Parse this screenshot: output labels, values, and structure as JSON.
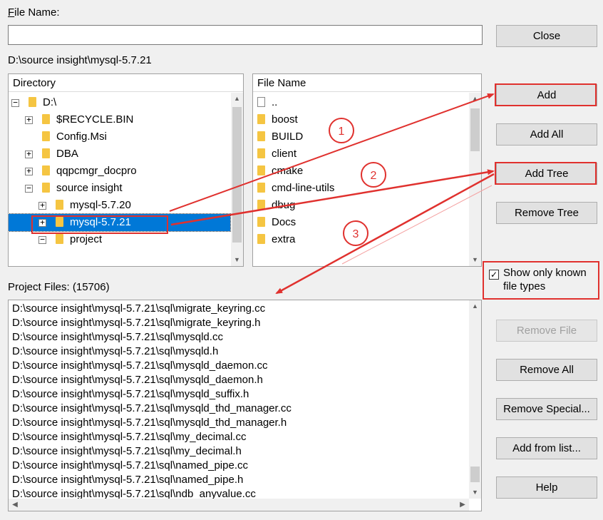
{
  "file_name": {
    "label": "File Name:",
    "value": ""
  },
  "current_path": "D:\\source insight\\mysql-5.7.21",
  "directory": {
    "header": "Directory",
    "items": [
      {
        "label": "D:\\",
        "expander": "−"
      },
      {
        "label": "$RECYCLE.BIN",
        "expander": "+"
      },
      {
        "label": "Config.Msi",
        "expander": ""
      },
      {
        "label": "DBA",
        "expander": "+"
      },
      {
        "label": "qqpcmgr_docpro",
        "expander": "+"
      },
      {
        "label": "source insight",
        "expander": "−"
      },
      {
        "label": "mysql-5.7.20",
        "expander": "+"
      },
      {
        "label": "mysql-5.7.21",
        "expander": "+",
        "selected": true
      },
      {
        "label": "project",
        "expander": "−"
      }
    ]
  },
  "filename_panel": {
    "header": "File Name",
    "items": [
      {
        "label": "..",
        "icon": "file"
      },
      {
        "label": "boost",
        "icon": "folder"
      },
      {
        "label": "BUILD",
        "icon": "folder"
      },
      {
        "label": "client",
        "icon": "folder"
      },
      {
        "label": "cmake",
        "icon": "folder"
      },
      {
        "label": "cmd-line-utils",
        "icon": "folder"
      },
      {
        "label": "dbug",
        "icon": "folder"
      },
      {
        "label": "Docs",
        "icon": "folder"
      },
      {
        "label": "extra",
        "icon": "folder"
      }
    ]
  },
  "project_files": {
    "label": "Project Files: (15706)",
    "items": [
      "D:\\source insight\\mysql-5.7.21\\sql\\migrate_keyring.cc",
      "D:\\source insight\\mysql-5.7.21\\sql\\migrate_keyring.h",
      "D:\\source insight\\mysql-5.7.21\\sql\\mysqld.cc",
      "D:\\source insight\\mysql-5.7.21\\sql\\mysqld.h",
      "D:\\source insight\\mysql-5.7.21\\sql\\mysqld_daemon.cc",
      "D:\\source insight\\mysql-5.7.21\\sql\\mysqld_daemon.h",
      "D:\\source insight\\mysql-5.7.21\\sql\\mysqld_suffix.h",
      "D:\\source insight\\mysql-5.7.21\\sql\\mysqld_thd_manager.cc",
      "D:\\source insight\\mysql-5.7.21\\sql\\mysqld_thd_manager.h",
      "D:\\source insight\\mysql-5.7.21\\sql\\my_decimal.cc",
      "D:\\source insight\\mysql-5.7.21\\sql\\my_decimal.h",
      "D:\\source insight\\mysql-5.7.21\\sql\\named_pipe.cc",
      "D:\\source insight\\mysql-5.7.21\\sql\\named_pipe.h",
      "D:\\source insight\\mysql-5.7.21\\sql\\ndb_anyvalue.cc"
    ]
  },
  "buttons": {
    "close": "Close",
    "add": "Add",
    "add_all": "Add All",
    "add_tree": "Add Tree",
    "remove_tree": "Remove Tree",
    "remove_file": "Remove File",
    "remove_all": "Remove All",
    "remove_special": "Remove Special...",
    "add_from_list": "Add from list...",
    "help": "Help"
  },
  "checkbox": {
    "label_line1": "Show only known",
    "label_line2": "file types",
    "checked": true
  },
  "annotations": [
    "1",
    "2",
    "3"
  ],
  "colors": {
    "selection": "#0078d7",
    "highlight": "#e0312e",
    "folder": "#f5c542"
  }
}
